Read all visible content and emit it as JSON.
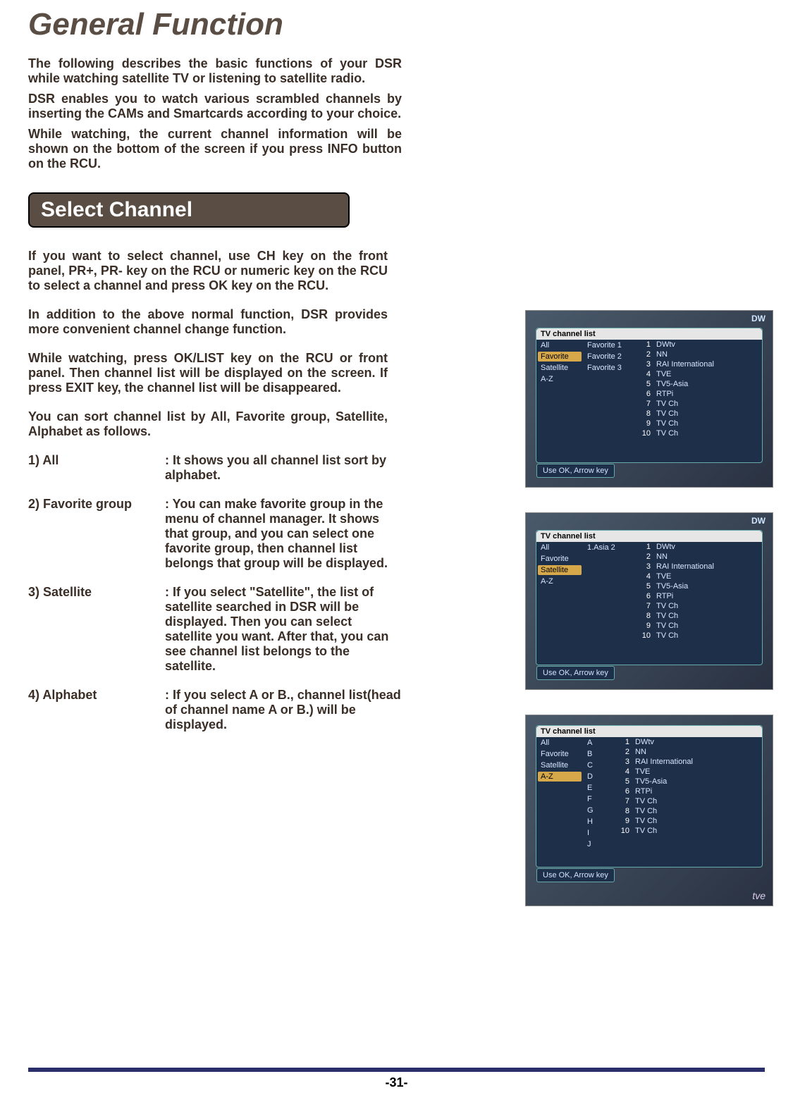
{
  "title": "General Function",
  "intro": {
    "p1": "The following describes the basic functions of your DSR while watching satellite TV or listening to satellite radio.",
    "p2": "DSR enables you to watch various scrambled channels by inserting the CAMs and  Smartcards according to your choice.",
    "p3": "While watching, the current channel information will be shown on the bottom of the screen if you press INFO button on the RCU."
  },
  "section_heading": "Select Channel",
  "body": {
    "p1": "If you want to select channel, use CH key on the front panel, PR+, PR- key on the RCU or numeric key on the RCU to select a channel and press OK key on the RCU.",
    "p2": "In addition to the above normal function, DSR provides more convenient channel change function.",
    "p3": "While watching, press OK/LIST key on the RCU or front panel. Then channel list will be displayed on the screen. If press EXIT key, the channel list will be disappeared.",
    "p4": "You can sort channel list by All, Favorite group, Satellite, Alphabet as follows."
  },
  "sort": [
    {
      "label": "1) All",
      "desc": ": It shows you all channel list sort by alphabet."
    },
    {
      "label": "2) Favorite group",
      "desc": ": You can make favorite group in the menu of channel manager. It shows that group, and you can select one favorite group, then channel list belongs that group will be displayed."
    },
    {
      "label": "3) Satellite",
      "desc": ": If you select \"Satellite\", the list of satellite searched in DSR will be displayed. Then you can select satellite you want. After that, you can see channel list belongs to the satellite."
    },
    {
      "label": "4) Alphabet",
      "desc": ": If you select A or B., channel list(head of channel name A or B.) will be displayed."
    }
  ],
  "screenshots": {
    "title": "TV channel list",
    "hint": "Use OK, Arrow key",
    "dw": "DW",
    "shot1": {
      "cats_left": [
        "All",
        "Favorite",
        "Satellite",
        "A-Z"
      ],
      "cats_top": [
        "Favorite 1",
        "Favorite 2",
        "Favorite 3"
      ],
      "sel": "Favorite",
      "channels": [
        "DWtv",
        "NN",
        "RAI International",
        "TVE",
        "TV5-Asia",
        "RTPi",
        "TV Ch",
        "TV Ch",
        "TV Ch",
        "TV Ch"
      ]
    },
    "shot2": {
      "cats_left": [
        "All",
        "Favorite",
        "Satellite",
        "A-Z"
      ],
      "cats_top": [
        "1.Asia 2"
      ],
      "sel": "Satellite",
      "channels": [
        "DWtv",
        "NN",
        "RAI International",
        "TVE",
        "TV5-Asia",
        "RTPi",
        "TV Ch",
        "TV Ch",
        "TV Ch",
        "TV Ch"
      ]
    },
    "shot3": {
      "cats_left": [
        "All",
        "Favorite",
        "Satellite",
        "A-Z"
      ],
      "alpha": [
        "A",
        "B",
        "C",
        "D",
        "E",
        "F",
        "G",
        "H",
        "I",
        "J"
      ],
      "sel": "A-Z",
      "channels": [
        "DWtv",
        "NN",
        "RAI International",
        "TVE",
        "TV5-Asia",
        "RTPi",
        "TV Ch",
        "TV Ch",
        "TV Ch",
        "TV Ch"
      ],
      "bottom_logo": "tve"
    }
  },
  "page_number": "-31-"
}
